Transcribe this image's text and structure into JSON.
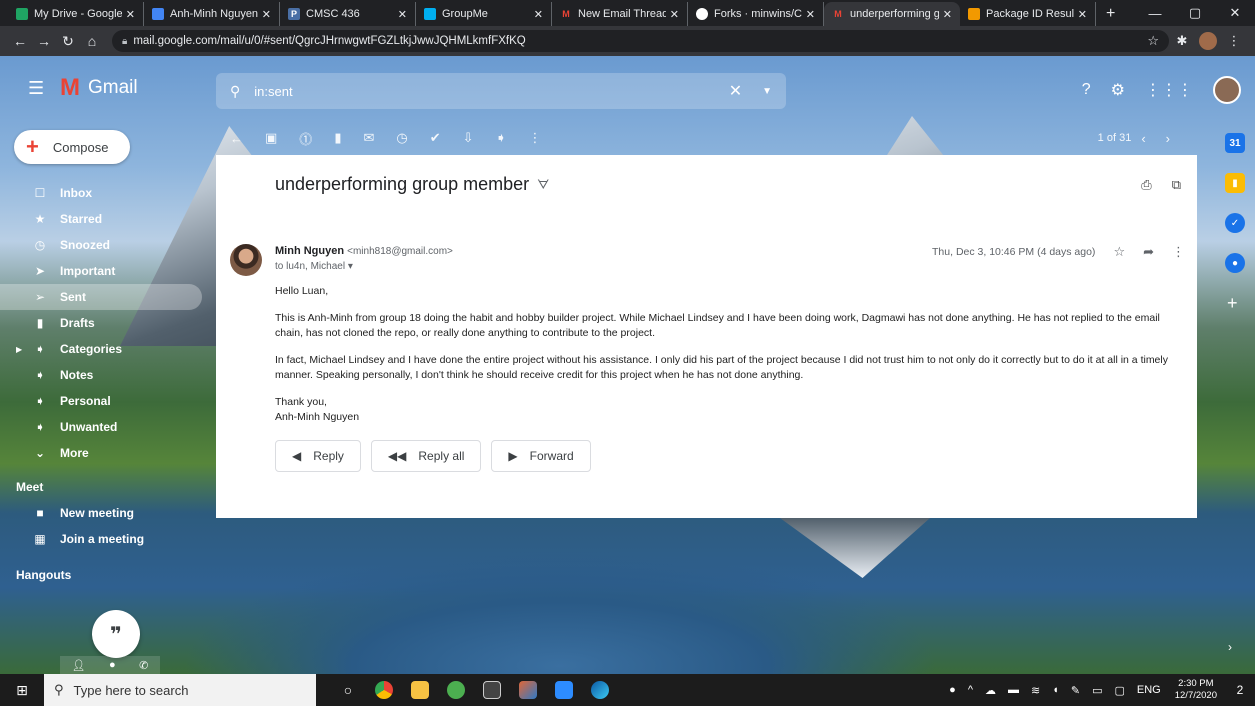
{
  "browser": {
    "tabs": [
      {
        "label": "My Drive - Google",
        "color": "#1fa463"
      },
      {
        "label": "Anh-Minh Nguyen",
        "color": "#4285f4"
      },
      {
        "label": "CMSC 436",
        "color": "#4a6fa5"
      },
      {
        "label": "GroupMe",
        "color": "#00aff0"
      },
      {
        "label": "New Email Thread",
        "color": "#ea4335"
      },
      {
        "label": "Forks · minwins/Ch",
        "color": "#ffffff"
      },
      {
        "label": "underperforming g",
        "color": "#ea4335"
      },
      {
        "label": "Package ID Results",
        "color": "#f29900"
      }
    ],
    "url": "mail.google.com/mail/u/0/#sent/QgrcJHrnwgwtFGZLtkjJwwJQHMLkmfFXfKQ"
  },
  "gmail": {
    "app_name": "Gmail",
    "search_value": "in:sent",
    "compose_label": "Compose",
    "nav": [
      {
        "label": "Inbox",
        "icon": "inbox-icon",
        "glyph": "☐"
      },
      {
        "label": "Starred",
        "icon": "star-icon",
        "glyph": "★"
      },
      {
        "label": "Snoozed",
        "icon": "clock-icon",
        "glyph": "◷"
      },
      {
        "label": "Important",
        "icon": "important-icon",
        "glyph": "➤"
      },
      {
        "label": "Sent",
        "icon": "send-icon",
        "glyph": "➢"
      },
      {
        "label": "Drafts",
        "icon": "draft-icon",
        "glyph": "▮"
      },
      {
        "label": "Categories",
        "icon": "label-icon",
        "glyph": "➧"
      },
      {
        "label": "Notes",
        "icon": "label-icon",
        "glyph": "➧"
      },
      {
        "label": "Personal",
        "icon": "label-icon",
        "glyph": "➧"
      },
      {
        "label": "Unwanted",
        "icon": "label-icon",
        "glyph": "➧"
      },
      {
        "label": "More",
        "icon": "chevron-down-icon",
        "glyph": "⌄"
      }
    ],
    "meet_title": "Meet",
    "meet_items": [
      {
        "label": "New meeting",
        "glyph": "■"
      },
      {
        "label": "Join a meeting",
        "glyph": "▦"
      }
    ],
    "hangouts_title": "Hangouts",
    "pager": "1 of 31"
  },
  "email": {
    "subject": "underperforming group member",
    "sender_name": "Minh Nguyen",
    "sender_email": "<minh818@gmail.com>",
    "recipients": "to lu4n, Michael",
    "date": "Thu, Dec 3, 10:46 PM (4 days ago)",
    "greeting": "Hello Luan,",
    "paragraph1": "This is Anh-Minh from group 18 doing the habit and hobby builder project. While Michael Lindsey and I have been doing work, Dagmawi has not done anything. He has not replied to the email chain, has not cloned the repo, or really done anything to contribute to the project.",
    "paragraph2": "In fact, Michael Lindsey and I have done the entire project without his assistance. I only did his part of the project because I did not trust him to not only do it correctly but to do it at all in a timely manner. Speaking personally, I don't think he should receive credit for this project when he has not done anything.",
    "closing": "Thank you,",
    "signature": "Anh-Minh Nguyen",
    "reply_label": "Reply",
    "reply_all_label": "Reply all",
    "forward_label": "Forward"
  },
  "taskbar": {
    "search_placeholder": "Type here to search",
    "language": "ENG",
    "time": "2:30 PM",
    "date": "12/7/2020",
    "notification_count": "2"
  }
}
